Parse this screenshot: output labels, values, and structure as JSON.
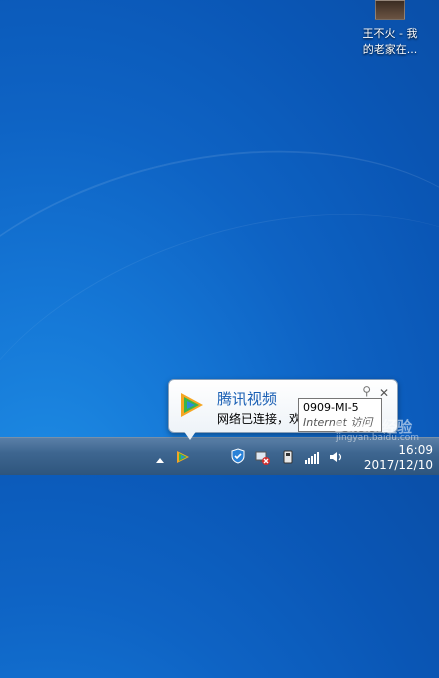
{
  "desktop": {
    "shortcut_label_line1": "王不火 - 我",
    "shortcut_label_line2": "的老家在..."
  },
  "balloon": {
    "title": "腾讯视频",
    "message": "网络已连接，欢",
    "close": "✕",
    "pin": "⚲"
  },
  "tooltip": {
    "line1": "0909-MI-5",
    "line2": "Internet 访问"
  },
  "clock": {
    "time": "16:09",
    "date": "2017/12/10"
  },
  "watermark": {
    "main": "Baidu经验",
    "sub": "jingyan.baidu.com"
  },
  "colors": {
    "wallpaper": "#0e63c4",
    "balloon_title": "#1a5fb4"
  }
}
